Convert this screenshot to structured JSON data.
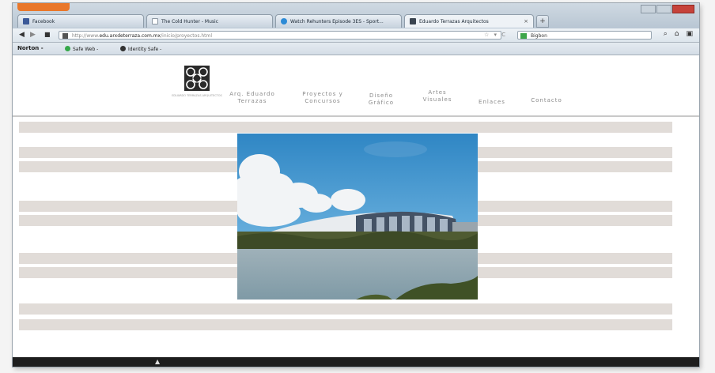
{
  "browser": {
    "tabs": [
      {
        "title": "Facebook",
        "icon": "facebook-icon",
        "active": false
      },
      {
        "title": "The Cold Hunter - Music",
        "icon": "page-icon",
        "active": false
      },
      {
        "title": "Watch Rehunters Episode 3ES - Sport...",
        "icon": "globe-icon",
        "active": false
      },
      {
        "title": "Eduardo Terrazas Arquitectos",
        "icon": "site-icon",
        "active": true
      }
    ],
    "new_tab_label": "+",
    "url_prefix": "http://www.",
    "url_domain": "edu.arxdeterraza.com.mx",
    "url_path": "/inicio/proyectos.html",
    "search_placeholder": "Bigbon",
    "bookmarks": [
      {
        "label": "Norton -"
      },
      {
        "label": "Safe Web -"
      },
      {
        "label": "Identity Safe -"
      }
    ]
  },
  "site": {
    "logo_caption": "EDUARDO TERRAZAS ARQUITECTOS",
    "menu": [
      {
        "line1": "Arq. Eduardo",
        "line2": "Terrazas"
      },
      {
        "line1": "Proyectos y",
        "line2": "Concursos"
      },
      {
        "line1": "Diseño",
        "line2": "Gráfico"
      },
      {
        "line1": "Artes",
        "line2": "Visuales"
      },
      {
        "line1": "Enlaces",
        "line2": ""
      },
      {
        "line1": "Contacto",
        "line2": ""
      }
    ]
  },
  "colors": {
    "firefox_button": "#e9772a",
    "stripe": "#e1dcd8",
    "menu_text": "#8a8a8a"
  }
}
